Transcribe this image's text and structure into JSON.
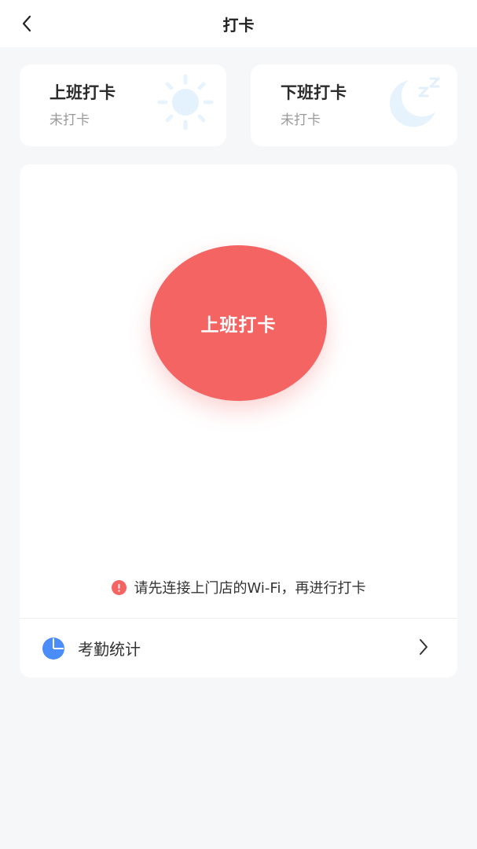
{
  "header": {
    "title": "打卡"
  },
  "cards": {
    "clock_in": {
      "title": "上班打卡",
      "status": "未打卡"
    },
    "clock_out": {
      "title": "下班打卡",
      "status": "未打卡"
    }
  },
  "main": {
    "punch_button_label": "上班打卡",
    "hint_text": "请先连接上门店的Wi-Fi，再进行打卡",
    "stats_label": "考勤统计"
  },
  "colors": {
    "accent_red": "#f46463",
    "stats_blue": "#4a8df8",
    "deco_light_blue": "#e6f3fd"
  }
}
